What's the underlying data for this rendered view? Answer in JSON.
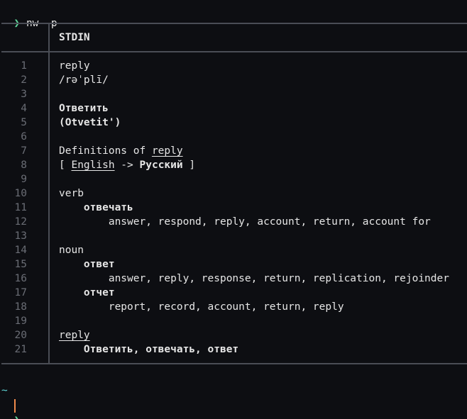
{
  "command": {
    "prompt_symbol": "❯",
    "text": "nw -p"
  },
  "header": {
    "label": "STDIN"
  },
  "lines": [
    {
      "num": "1",
      "segments": [
        {
          "t": "reply"
        }
      ]
    },
    {
      "num": "2",
      "segments": [
        {
          "t": "/rəˈplī/"
        }
      ]
    },
    {
      "num": "3",
      "segments": []
    },
    {
      "num": "4",
      "segments": [
        {
          "t": "Ответить",
          "bold": true
        }
      ]
    },
    {
      "num": "5",
      "segments": [
        {
          "t": "(Otvetit')",
          "bold": true
        }
      ]
    },
    {
      "num": "6",
      "segments": []
    },
    {
      "num": "7",
      "segments": [
        {
          "t": "Definitions of "
        },
        {
          "t": "reply",
          "underline": true
        }
      ]
    },
    {
      "num": "8",
      "segments": [
        {
          "t": "[ "
        },
        {
          "t": "English",
          "underline": true
        },
        {
          "t": " -> "
        },
        {
          "t": "Русский",
          "bold": true
        },
        {
          "t": " ]"
        }
      ]
    },
    {
      "num": "9",
      "segments": []
    },
    {
      "num": "10",
      "segments": [
        {
          "t": "verb"
        }
      ]
    },
    {
      "num": "11",
      "segments": [
        {
          "t": "    "
        },
        {
          "t": "отвечать",
          "bold": true
        }
      ]
    },
    {
      "num": "12",
      "segments": [
        {
          "t": "        answer, respond, reply, account, return, account for"
        }
      ]
    },
    {
      "num": "13",
      "segments": []
    },
    {
      "num": "14",
      "segments": [
        {
          "t": "noun"
        }
      ]
    },
    {
      "num": "15",
      "segments": [
        {
          "t": "    "
        },
        {
          "t": "ответ",
          "bold": true
        }
      ]
    },
    {
      "num": "16",
      "segments": [
        {
          "t": "        answer, reply, response, return, replication, rejoinder"
        }
      ]
    },
    {
      "num": "17",
      "segments": [
        {
          "t": "    "
        },
        {
          "t": "отчет",
          "bold": true
        }
      ]
    },
    {
      "num": "18",
      "segments": [
        {
          "t": "        report, record, account, return, reply"
        }
      ]
    },
    {
      "num": "19",
      "segments": []
    },
    {
      "num": "20",
      "segments": [
        {
          "t": "reply",
          "underline": true
        }
      ]
    },
    {
      "num": "21",
      "segments": [
        {
          "t": "    "
        },
        {
          "t": "Ответить, отвечать, ответ",
          "bold": true
        }
      ]
    }
  ],
  "footer": {
    "tilde": "~",
    "prompt_symbol": "❯"
  },
  "colors": {
    "background": "#0d0e12",
    "prompt": "#5fd79b",
    "tilde": "#5fd7d7",
    "cursor": "#f08a4b",
    "line_number": "#6a6d75",
    "rule": "#4a4d55"
  },
  "icons": {
    "prompt": "chevron-right-icon",
    "cursor": "text-cursor"
  }
}
